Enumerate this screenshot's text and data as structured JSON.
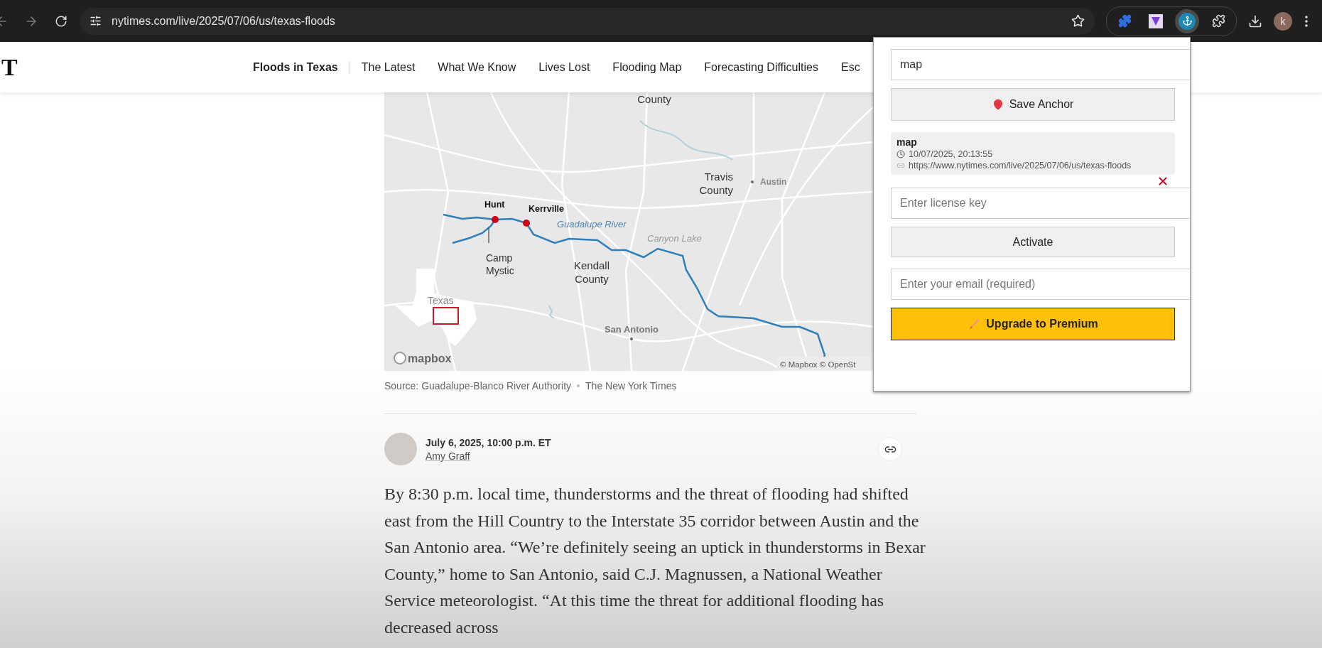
{
  "browser": {
    "url": "nytimes.com/live/2025/07/06/us/texas-floods",
    "profile_initial": "k"
  },
  "site": {
    "logo": "T",
    "nav": [
      {
        "label": "Floods in Texas",
        "selected": true
      },
      {
        "label": "The Latest",
        "selected": false
      },
      {
        "label": "What We Know",
        "selected": false
      },
      {
        "label": "Lives Lost",
        "selected": false
      },
      {
        "label": "Flooding Map",
        "selected": false
      },
      {
        "label": "Forecasting Difficulties",
        "selected": false
      },
      {
        "label": "Esc",
        "selected": false
      }
    ]
  },
  "map": {
    "labels": {
      "county_top": "County",
      "travis": "Travis",
      "travis_county": "County",
      "austin": "Austin",
      "hunt": "Hunt",
      "kerrville": "Kerrville",
      "river": "Guadalupe River",
      "lake": "Canyon Lake",
      "camp": "Camp",
      "camp_2": "Mystic",
      "kendall": "Kendall",
      "kendall_county": "County",
      "texas": "Texas",
      "san_antonio": "San Antonio",
      "mapbox": "mapbox",
      "attribution": "© Mapbox © OpenSt"
    }
  },
  "caption": {
    "source": "Source: Guadalupe-Blanco River Authority",
    "credit": "The New York Times"
  },
  "post": {
    "time": "July 6, 2025, 10:00 p.m. ET",
    "author": "Amy Graff",
    "body": "By 8:30 p.m. local time, thunderstorms and the threat of flooding had shifted east from the Hill Country to the Interstate 35 corridor between Austin and the San Antonio area. “We’re definitely seeing an uptick in thunderstorms in Bexar County,” home to San Antonio, said C.J. Magnussen, a National Weather Service meteorologist. “At this time the threat for additional flooding has decreased across"
  },
  "popup": {
    "anchor_value": "map",
    "save_label": "Save Anchor",
    "anchors": [
      {
        "title": "map",
        "time": "10/07/2025, 20:13:55",
        "url": "https://www.nytimes.com/live/2025/07/06/us/texas-floods"
      }
    ],
    "license_placeholder": "Enter license key",
    "activate_label": "Activate",
    "email_placeholder": "Enter your email (required)",
    "upgrade_label": "Upgrade to Premium"
  }
}
